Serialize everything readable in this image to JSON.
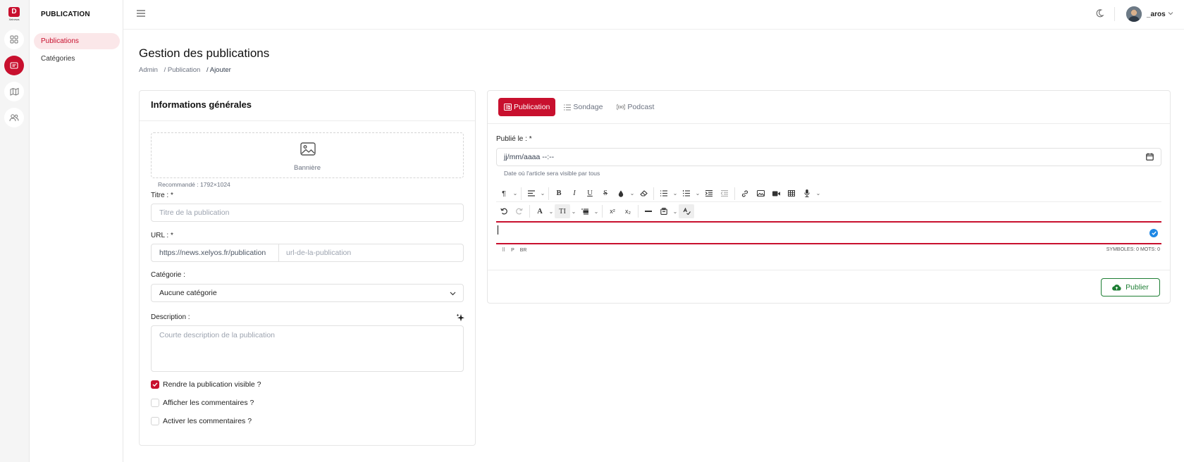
{
  "brand": {
    "logo_text": "D",
    "logo_caption": "Xelnews"
  },
  "rail": {
    "items": [
      "grid-icon",
      "publication-icon",
      "map-icon",
      "users-icon"
    ],
    "active_index": 1
  },
  "subnav": {
    "title": "PUBLICATION",
    "items": [
      {
        "label": "Publications",
        "active": true
      },
      {
        "label": "Catégories",
        "active": false
      }
    ]
  },
  "topbar": {
    "username": "_aros"
  },
  "page": {
    "title": "Gestion des publications",
    "breadcrumb": [
      "Admin",
      "/ Publication",
      "/ Ajouter"
    ]
  },
  "general": {
    "heading": "Informations générales",
    "banner_label": "Bannière",
    "banner_recommend": "Recommandé : 1792×1024",
    "title_label": "Titre : *",
    "title_placeholder": "Titre de la publication",
    "url_label": "URL : *",
    "url_prefix": "https://news.xelyos.fr/publication",
    "url_placeholder": "url-de-la-publication",
    "category_label": "Catégorie :",
    "category_value": "Aucune catégorie",
    "description_label": "Description :",
    "description_placeholder": "Courte description de la publication",
    "checkboxes": [
      {
        "label": "Rendre la publication visible ?",
        "checked": true
      },
      {
        "label": "Afficher les commentaires ?",
        "checked": false
      },
      {
        "label": "Activer les commentaires ?",
        "checked": false
      }
    ]
  },
  "content": {
    "tabs": [
      {
        "label": "Publication",
        "active": true
      },
      {
        "label": "Sondage",
        "active": false
      },
      {
        "label": "Podcast",
        "active": false
      }
    ],
    "published_label": "Publié le : *",
    "published_placeholder": "jj/mm/aaaa --:--",
    "published_hint": "Date où l'article sera visible par tous",
    "editor_status_left": [
      "P",
      "BR"
    ],
    "editor_status_right": "SYMBOLES: 0  MOTS: 0",
    "submit_label": "Publier"
  },
  "colors": {
    "accent": "#c8102e",
    "success": "#1e7e34",
    "info": "#1e88e5"
  }
}
